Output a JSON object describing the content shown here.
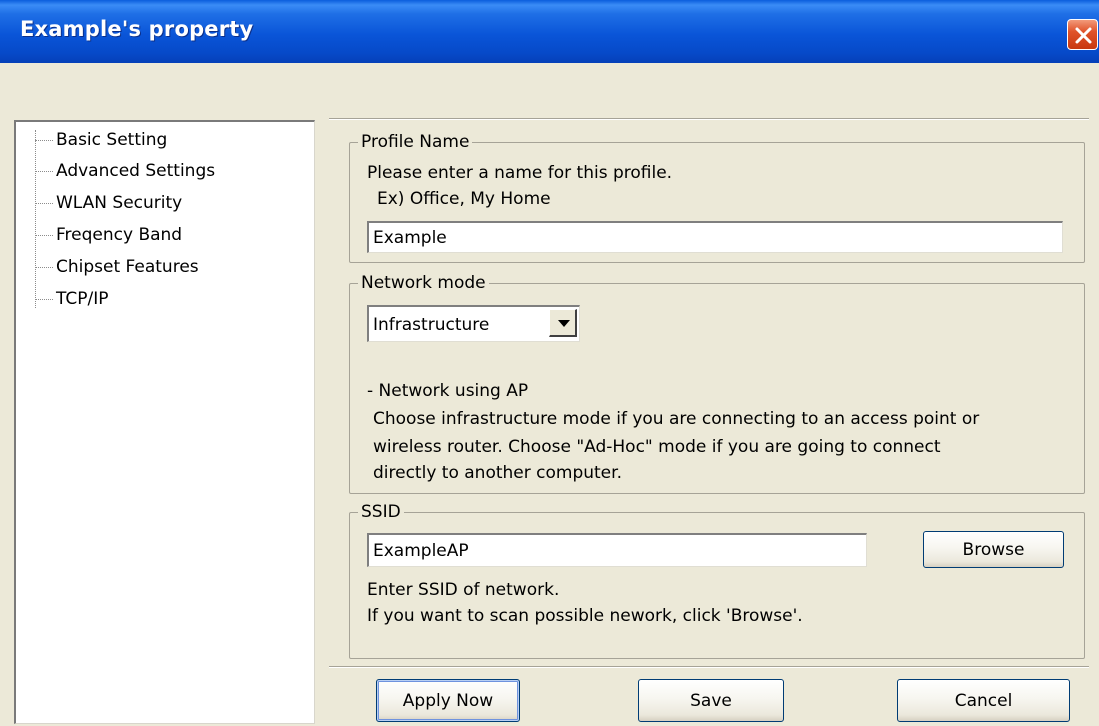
{
  "window": {
    "title": "Example's property"
  },
  "nav": {
    "items": [
      {
        "label": "Basic Setting"
      },
      {
        "label": "Advanced Settings"
      },
      {
        "label": "WLAN Security"
      },
      {
        "label": "Freqency Band"
      },
      {
        "label": "Chipset Features"
      },
      {
        "label": "TCP/IP"
      }
    ]
  },
  "profile": {
    "legend": "Profile Name",
    "instruction": "Please enter a name for this profile.",
    "example": "Ex) Office, My Home",
    "value": "Example"
  },
  "network": {
    "legend": "Network mode",
    "selected": "Infrastructure",
    "desc_title": "- Network using AP",
    "desc_lines": [
      "Choose infrastructure mode if you are connecting to an access point or",
      "wireless router. Choose \"Ad-Hoc\" mode if you are going to connect",
      "directly to another computer."
    ]
  },
  "ssid": {
    "legend": "SSID",
    "value": "ExampleAP",
    "browse_label": "Browse",
    "help_lines": [
      "Enter SSID of network.",
      "If you want to scan possible nework, click 'Browse'."
    ]
  },
  "buttons": {
    "apply_label": "Apply Now",
    "save_label": "Save",
    "cancel_label": "Cancel"
  }
}
